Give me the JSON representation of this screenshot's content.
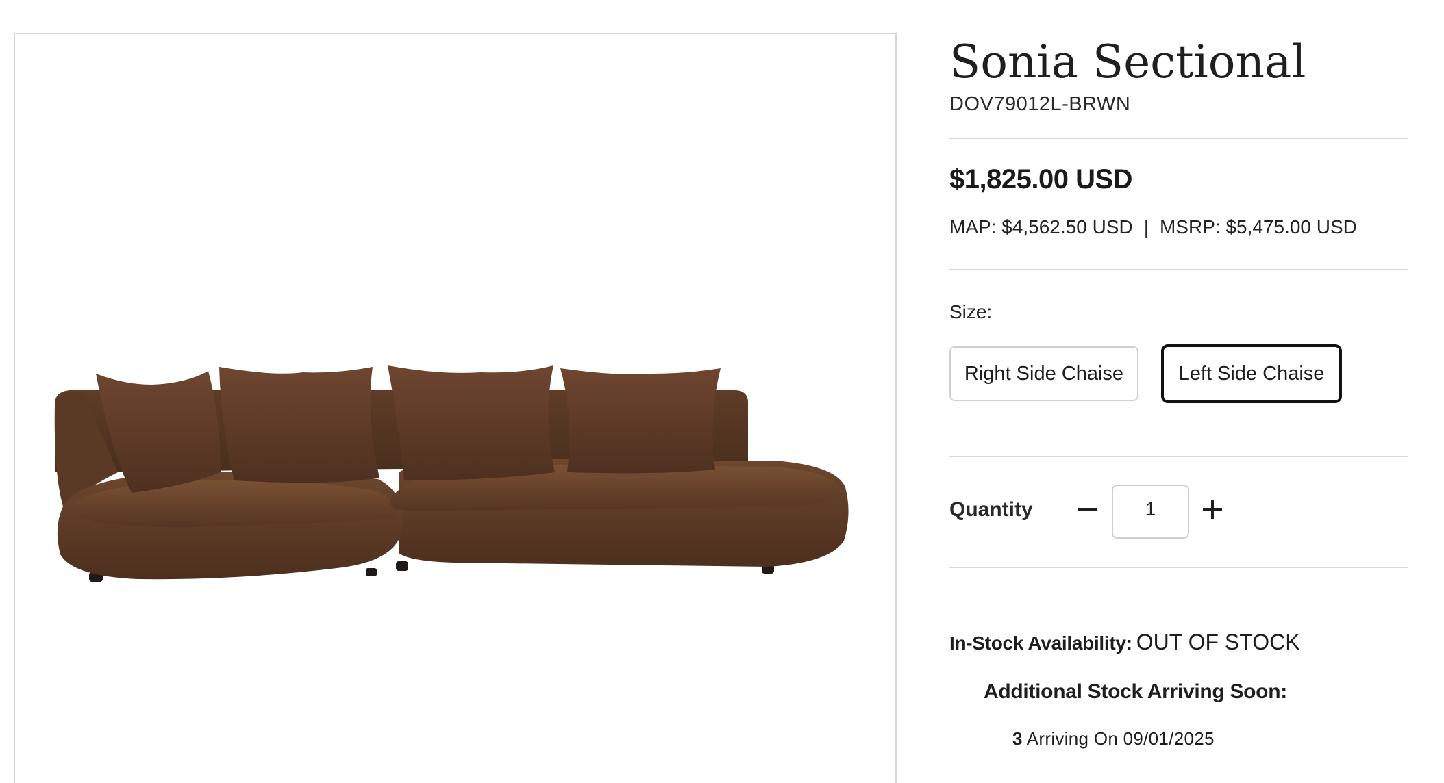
{
  "product": {
    "title": "Sonia Sectional",
    "sku": "DOV79012L-BRWN",
    "image_alt": "Brown boucle curved sectional sofa with four back cushions",
    "color_swatch": "#5b3a24"
  },
  "pricing": {
    "price": "$1,825.00 USD",
    "map": "MAP: $4,562.50 USD",
    "separator": "|",
    "msrp": "MSRP: $5,475.00 USD"
  },
  "size": {
    "label": "Size:",
    "options": [
      {
        "label": "Right Side Chaise",
        "selected": false
      },
      {
        "label": "Left Side Chaise",
        "selected": true
      }
    ]
  },
  "quantity": {
    "label": "Quantity",
    "value": "1",
    "decrement_icon": "minus-icon",
    "increment_icon": "plus-icon"
  },
  "stock": {
    "label": "In-Stock Availability:",
    "status": "OUT OF STOCK",
    "arriving_heading": "Additional Stock Arriving Soon:",
    "arriving_count": "3",
    "arriving_text": "Arriving On 09/01/2025"
  }
}
